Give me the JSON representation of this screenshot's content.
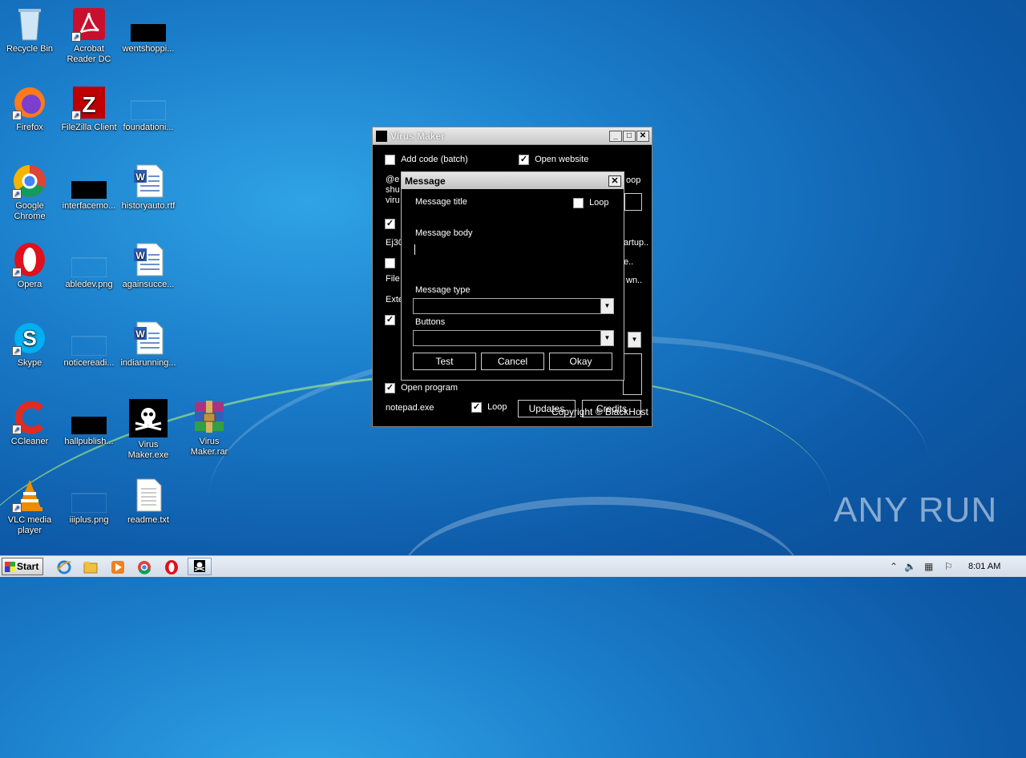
{
  "desktop": {
    "icons": [
      {
        "label": "Recycle Bin",
        "icon": "recycle-bin-icon"
      },
      {
        "label": "Acrobat Reader DC",
        "icon": "acrobat-icon"
      },
      {
        "label": "wentshoppi...",
        "icon": "black-file-icon"
      },
      {
        "label": "Firefox",
        "icon": "firefox-icon"
      },
      {
        "label": "FileZilla Client",
        "icon": "filezilla-icon"
      },
      {
        "label": "foundationi...",
        "icon": "blank-file-icon"
      },
      {
        "label": "Google Chrome",
        "icon": "chrome-icon"
      },
      {
        "label": "interfacemo...",
        "icon": "black-file-icon"
      },
      {
        "label": "historyauto.rtf",
        "icon": "word-doc-icon"
      },
      {
        "label": "Opera",
        "icon": "opera-icon"
      },
      {
        "label": "abledev.png",
        "icon": "blank-file-icon"
      },
      {
        "label": "againsucce...",
        "icon": "word-doc-icon"
      },
      {
        "label": "Skype",
        "icon": "skype-icon"
      },
      {
        "label": "noticereadi...",
        "icon": "blank-file-icon"
      },
      {
        "label": "indiarunning...",
        "icon": "word-doc-icon"
      },
      {
        "label": "CCleaner",
        "icon": "ccleaner-icon"
      },
      {
        "label": "hallpublish...",
        "icon": "black-file-icon"
      },
      {
        "label": "Virus Maker.exe",
        "icon": "pirate-skull-icon"
      },
      {
        "label": "Virus Maker.rar",
        "icon": "winrar-icon"
      },
      {
        "label": "VLC media player",
        "icon": "vlc-icon"
      },
      {
        "label": "iiiplus.png",
        "icon": "blank-file-icon"
      },
      {
        "label": "readme.txt",
        "icon": "text-file-icon"
      }
    ]
  },
  "watermark": "ANY RUN",
  "virus_maker": {
    "title": "Virus Maker",
    "add_code_label": "Add code (batch)",
    "add_code_checked": false,
    "open_website_label": "Open website",
    "open_website_checked": true,
    "code_fragment_1": "@e",
    "code_fragment_2": "shu",
    "code_fragment_3": "viru",
    "loop_fragment": "oop",
    "ej_fragment": "Ej30",
    "startup_fragment": "artup..",
    "file_fragment": "File",
    "dots_fragment": "e..",
    "ext_fragment": "Exte",
    "wn_fragment": "wn..",
    "open_program_label": "Open program",
    "open_program_checked": true,
    "program_value": "notepad.exe",
    "loop_label": "Loop",
    "loop_checked": true,
    "updates_button": "Updates",
    "credits_button": "Credits",
    "copyright": "Copyright © BlackHost"
  },
  "message_dialog": {
    "title": "Message",
    "close_label": "✕",
    "message_title_label": "Message title",
    "loop_label": "Loop",
    "loop_checked": false,
    "message_body_label": "Message body",
    "message_type_label": "Message type",
    "message_type_value": "",
    "buttons_label": "Buttons",
    "buttons_value": "",
    "test_button": "Test",
    "cancel_button": "Cancel",
    "okay_button": "Okay"
  },
  "taskbar": {
    "start_label": "Start",
    "clock": "8:01 AM"
  }
}
